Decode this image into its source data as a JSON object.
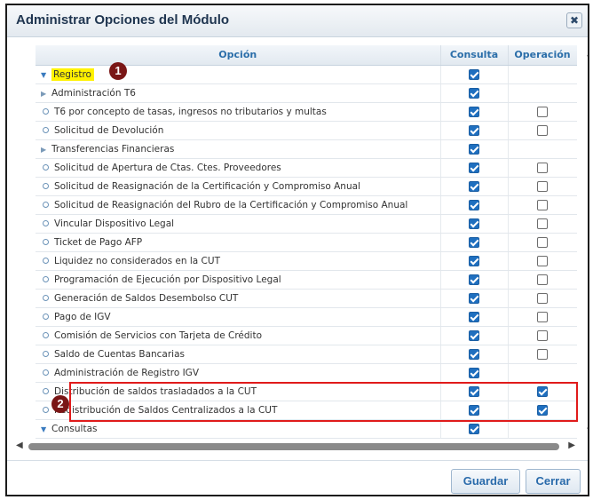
{
  "dialog": {
    "title": "Administrar Opciones del Módulo",
    "close_symbol": "✖"
  },
  "grid": {
    "columns": {
      "option": "Opción",
      "consulta": "Consulta",
      "operacion": "Operación"
    },
    "rows": [
      {
        "label": "Registro",
        "level": 0,
        "kind": "expanded",
        "highlight": true,
        "consulta": true,
        "operacion": null
      },
      {
        "label": "Administración T6",
        "level": 1,
        "kind": "collapsed",
        "consulta": true,
        "operacion": null
      },
      {
        "label": "T6 por concepto de tasas, ingresos no tributarios y multas",
        "level": 1,
        "kind": "leaf",
        "consulta": true,
        "operacion": false
      },
      {
        "label": "Solicitud de Devolución",
        "level": 1,
        "kind": "leaf",
        "consulta": true,
        "operacion": false
      },
      {
        "label": "Transferencias Financieras",
        "level": 1,
        "kind": "collapsed",
        "consulta": true,
        "operacion": null
      },
      {
        "label": "Solicitud de Apertura de Ctas. Ctes. Proveedores",
        "level": 1,
        "kind": "leaf",
        "consulta": true,
        "operacion": false
      },
      {
        "label": "Solicitud de Reasignación de la Certificación y Compromiso Anual",
        "level": 1,
        "kind": "leaf",
        "consulta": true,
        "operacion": false
      },
      {
        "label": "Solicitud de Reasignación del Rubro de la Certificación y Compromiso Anual",
        "level": 1,
        "kind": "leaf",
        "consulta": true,
        "operacion": false
      },
      {
        "label": "Vincular Dispositivo Legal",
        "level": 1,
        "kind": "leaf",
        "consulta": true,
        "operacion": false
      },
      {
        "label": "Ticket de Pago AFP",
        "level": 1,
        "kind": "leaf",
        "consulta": true,
        "operacion": false
      },
      {
        "label": "Liquidez no considerados en la CUT",
        "level": 1,
        "kind": "leaf",
        "consulta": true,
        "operacion": false
      },
      {
        "label": "Programación de Ejecución por Dispositivo Legal",
        "level": 1,
        "kind": "leaf",
        "consulta": true,
        "operacion": false
      },
      {
        "label": "Generación de Saldos Desembolso CUT",
        "level": 1,
        "kind": "leaf",
        "consulta": true,
        "operacion": false
      },
      {
        "label": "Pago de IGV",
        "level": 1,
        "kind": "leaf",
        "consulta": true,
        "operacion": false
      },
      {
        "label": "Comisión de Servicios con Tarjeta de Crédito",
        "level": 1,
        "kind": "leaf",
        "consulta": true,
        "operacion": false
      },
      {
        "label": "Saldo de Cuentas Bancarias",
        "level": 1,
        "kind": "leaf",
        "consulta": true,
        "operacion": false
      },
      {
        "label": "Administración de Registro IGV",
        "level": 1,
        "kind": "leaf",
        "consulta": true,
        "operacion": null
      },
      {
        "label": "Distribución de saldos trasladados a la CUT",
        "level": 1,
        "kind": "leaf",
        "consulta": true,
        "operacion": true
      },
      {
        "label": "Redistribución de Saldos Centralizados a la CUT",
        "level": 1,
        "kind": "leaf",
        "consulta": true,
        "operacion": true
      },
      {
        "label": "Consultas",
        "level": 0,
        "kind": "expanded",
        "consulta": true,
        "operacion": null
      }
    ]
  },
  "annotations": {
    "badge1": "1",
    "badge2": "2"
  },
  "buttons": {
    "save": "Guardar",
    "close": "Cerrar"
  },
  "icons": {
    "expanded": "triangle-down-icon",
    "collapsed": "triangle-right-icon",
    "leaf": "circle-bullet-icon"
  },
  "colors": {
    "checkbox_checked": "#1f6fbf",
    "highlight": "#fff200",
    "annotation_box": "#e01b1b",
    "badge": "#7a1616",
    "header_text": "#2b6ea9"
  }
}
